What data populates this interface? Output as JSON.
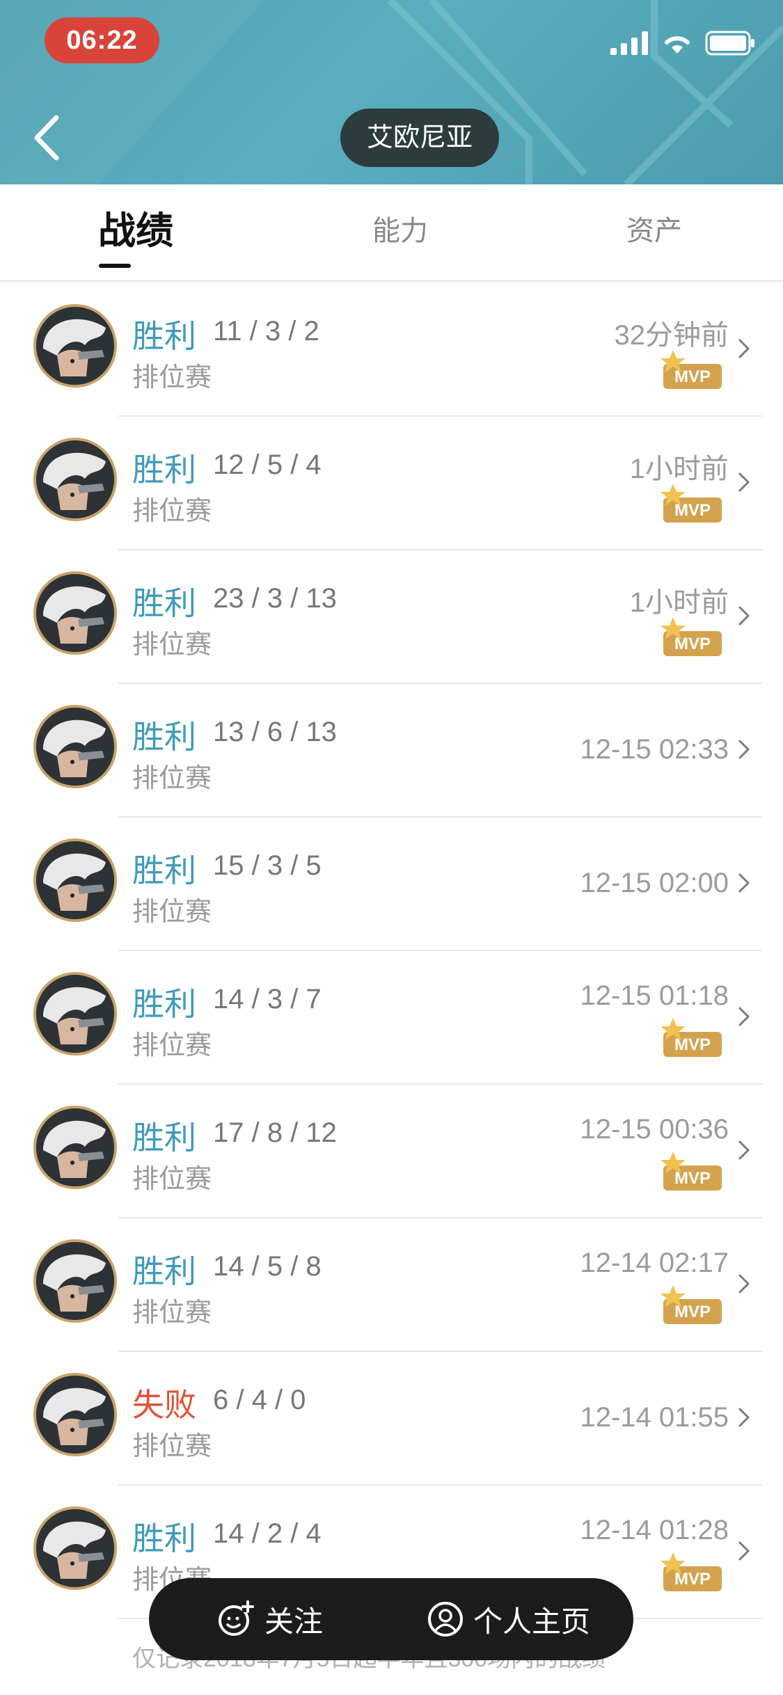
{
  "status_bar": {
    "time": "06:22"
  },
  "header": {
    "title": "艾欧尼亚"
  },
  "tabs": [
    {
      "label": "战绩",
      "active": true
    },
    {
      "label": "能力",
      "active": false
    },
    {
      "label": "资产",
      "active": false
    }
  ],
  "matches": [
    {
      "result": "胜利",
      "outcome": "win",
      "kda": "11 / 3 / 2",
      "mode": "排位赛",
      "time": "32分钟前",
      "mvp": true
    },
    {
      "result": "胜利",
      "outcome": "win",
      "kda": "12 / 5 / 4",
      "mode": "排位赛",
      "time": "1小时前",
      "mvp": true
    },
    {
      "result": "胜利",
      "outcome": "win",
      "kda": "23 / 3 / 13",
      "mode": "排位赛",
      "time": "1小时前",
      "mvp": true
    },
    {
      "result": "胜利",
      "outcome": "win",
      "kda": "13 / 6 / 13",
      "mode": "排位赛",
      "time": "12-15 02:33",
      "mvp": false
    },
    {
      "result": "胜利",
      "outcome": "win",
      "kda": "15 / 3 / 5",
      "mode": "排位赛",
      "time": "12-15 02:00",
      "mvp": false
    },
    {
      "result": "胜利",
      "outcome": "win",
      "kda": "14 / 3 / 7",
      "mode": "排位赛",
      "time": "12-15 01:18",
      "mvp": true
    },
    {
      "result": "胜利",
      "outcome": "win",
      "kda": "17 / 8 / 12",
      "mode": "排位赛",
      "time": "12-15 00:36",
      "mvp": true
    },
    {
      "result": "胜利",
      "outcome": "win",
      "kda": "14 / 5 / 8",
      "mode": "排位赛",
      "time": "12-14 02:17",
      "mvp": true
    },
    {
      "result": "失败",
      "outcome": "lose",
      "kda": "6 / 4 / 0",
      "mode": "排位赛",
      "time": "12-14 01:55",
      "mvp": false
    },
    {
      "result": "胜利",
      "outcome": "win",
      "kda": "14 / 2 / 4",
      "mode": "排位赛",
      "time": "12-14 01:28",
      "mvp": true
    }
  ],
  "mvp_badge_label": "MVP",
  "footer": {
    "note": "仅记录2018年7月5日起半年且300场内的战绩",
    "follow_label": "关注",
    "profile_label": "个人主页"
  },
  "colors": {
    "header": "#4d9fb0",
    "win": "#3e9bbd",
    "lose": "#e25238",
    "time_pill": "#d9443a",
    "mvp": "#d4a24e"
  }
}
